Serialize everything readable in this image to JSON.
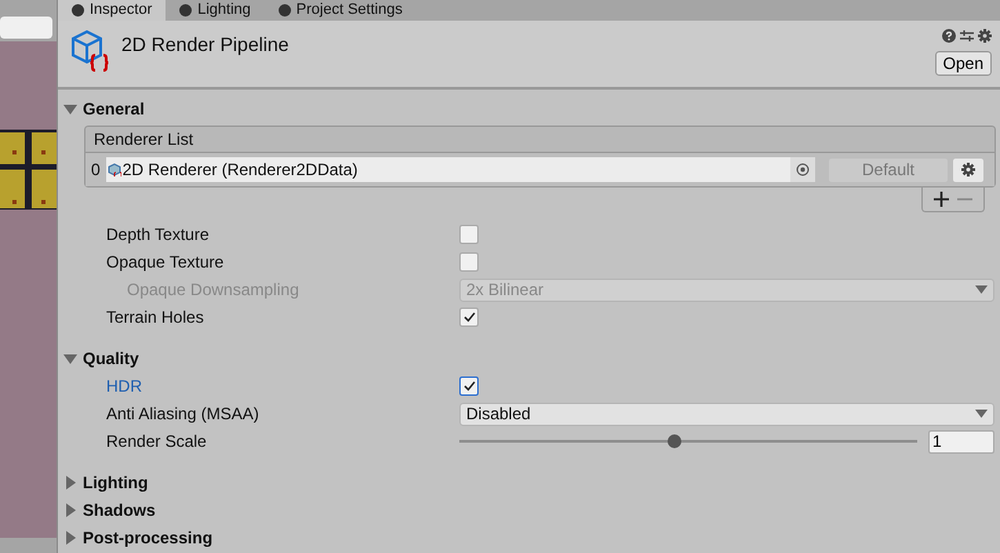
{
  "tabs": [
    {
      "label": "Inspector",
      "selected": true
    },
    {
      "label": "Lighting",
      "selected": false
    },
    {
      "label": "Project Settings",
      "selected": false
    }
  ],
  "header": {
    "title": "2D Render Pipeline",
    "open_button": "Open"
  },
  "sections": [
    {
      "title": "General",
      "expanded": true,
      "renderer_list": {
        "title": "Renderer List",
        "rows": [
          {
            "index": "0",
            "value": "2D Renderer (Renderer2DData)",
            "default_button": "Default"
          }
        ]
      },
      "properties": [
        {
          "kind": "checkbox",
          "label": "Depth Texture",
          "checked": false
        },
        {
          "kind": "checkbox",
          "label": "Opaque Texture",
          "checked": false,
          "children": [
            {
              "kind": "dropdown",
              "label": "Opaque Downsampling",
              "value": "2x Bilinear",
              "disabled": true
            }
          ]
        },
        {
          "kind": "checkbox",
          "label": "Terrain Holes",
          "checked": true
        }
      ]
    },
    {
      "title": "Quality",
      "expanded": true,
      "properties": [
        {
          "kind": "checkbox",
          "label": "HDR",
          "checked": true,
          "focused": true
        },
        {
          "kind": "dropdown",
          "label": "Anti Aliasing (MSAA)",
          "value": "Disabled"
        },
        {
          "kind": "slider",
          "label": "Render Scale",
          "level": 0.47,
          "value": "1"
        }
      ]
    },
    {
      "title": "Lighting",
      "expanded": false
    },
    {
      "title": "Shadows",
      "expanded": false
    },
    {
      "title": "Post-processing",
      "expanded": false
    }
  ]
}
